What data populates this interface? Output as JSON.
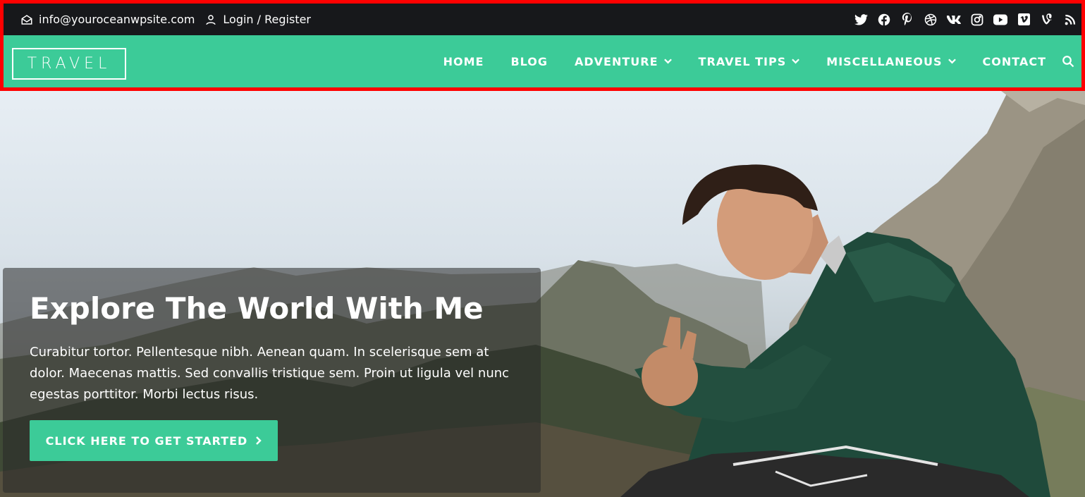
{
  "topbar": {
    "email": "info@youroceanwpsite.com",
    "auth": "Login / Register",
    "email_icon": "envelope-open-icon",
    "user_icon": "user-icon",
    "social_icons": [
      "twitter-icon",
      "facebook-icon",
      "pinterest-icon",
      "dribbble-icon",
      "vk-icon",
      "instagram-icon",
      "youtube-icon",
      "vimeo-icon",
      "vine-icon",
      "rss-icon"
    ]
  },
  "navbar": {
    "logo": "TRAVEL",
    "items": [
      {
        "label": "HOME"
      },
      {
        "label": "BLOG"
      },
      {
        "label": "ADVENTURE"
      },
      {
        "label": "TRAVEL TIPS"
      },
      {
        "label": "MISCELLANEOUS"
      },
      {
        "label": "CONTACT"
      }
    ],
    "search_icon": "search-icon"
  },
  "hero": {
    "title": "Explore The World With Me",
    "text": "Curabitur tortor. Pellentesque nibh. Aenean quam. In scelerisque sem at dolor. Maecenas mattis. Sed convallis tristique sem. Proin ut ligula vel nunc egestas porttitor. Morbi lectus risus.",
    "cta": "CLICK HERE TO GET STARTED"
  },
  "colors": {
    "accent": "#3ccb98",
    "topbar_bg": "#17181b",
    "highlight_border": "#ff0000"
  }
}
